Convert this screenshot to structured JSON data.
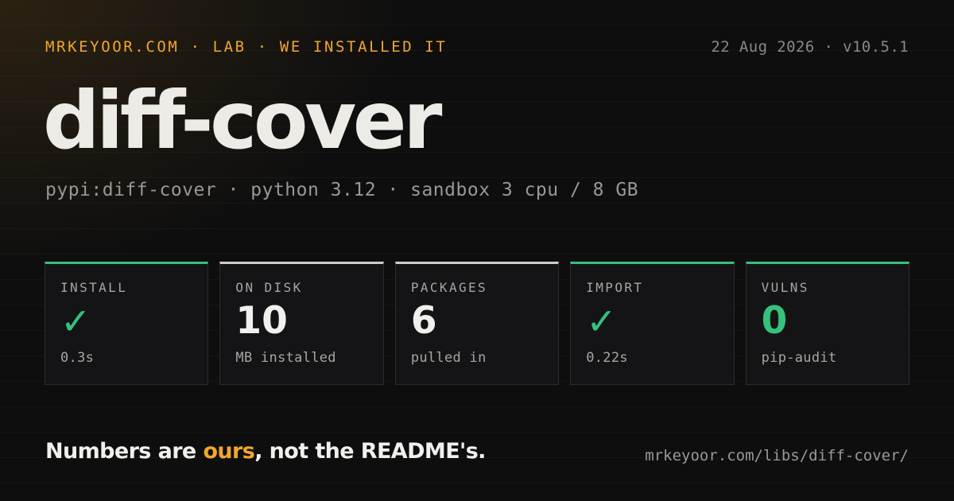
{
  "header": {
    "kicker": "MRKEYOOR.COM · LAB · WE INSTALLED IT",
    "meta": "22 Aug 2026 · v10.5.1"
  },
  "title": "diff-cover",
  "subtitle": "pypi:diff-cover · python 3.12 · sandbox 3 cpu / 8 GB",
  "cards": [
    {
      "label": "INSTALL",
      "value": "✓",
      "sub": "0.3s",
      "accent": "#34c27a",
      "status": "ok"
    },
    {
      "label": "ON DISK",
      "value": "10",
      "sub": "MB installed",
      "accent": "#cfcdc8",
      "status": "neutral"
    },
    {
      "label": "PACKAGES",
      "value": "6",
      "sub": "pulled in",
      "accent": "#cfcdc8",
      "status": "neutral"
    },
    {
      "label": "IMPORT",
      "value": "✓",
      "sub": "0.22s",
      "accent": "#34c27a",
      "status": "ok"
    },
    {
      "label": "VULNS",
      "value": "0",
      "sub": "pip-audit",
      "accent": "#34c27a",
      "status": "ok"
    }
  ],
  "footer": {
    "tagline_before": "Numbers are ",
    "tagline_accent": "ours",
    "tagline_after": ", not the README's.",
    "url": "mrkeyoor.com/libs/diff-cover/"
  },
  "colors": {
    "background": "#0e0e0f",
    "accent_orange": "#f0a62e",
    "accent_green": "#34c27a",
    "text_primary": "#ecebe6",
    "text_muted": "#9a9895"
  }
}
